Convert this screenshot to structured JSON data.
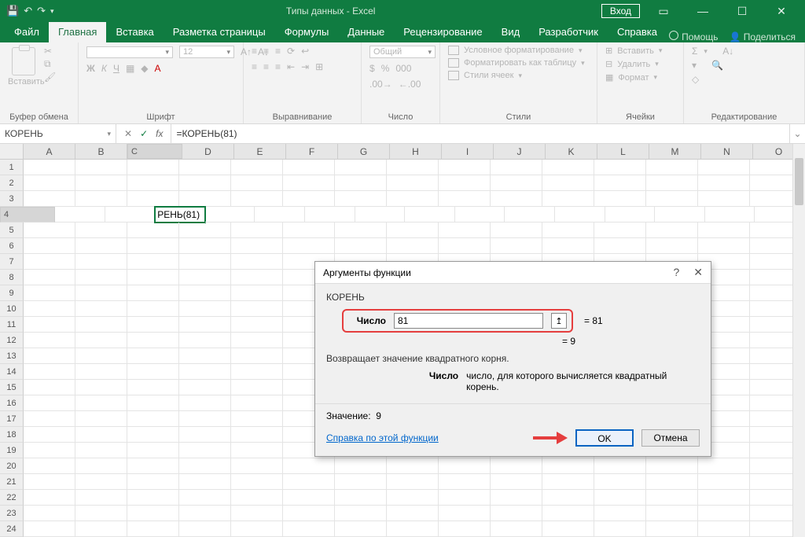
{
  "title": "Типы данных  -  Excel",
  "signin": "Вход",
  "tabs": {
    "file": "Файл",
    "home": "Главная",
    "insert": "Вставка",
    "layout": "Разметка страницы",
    "formulas": "Формулы",
    "data": "Данные",
    "review": "Рецензирование",
    "view": "Вид",
    "developer": "Разработчик",
    "help": "Справка",
    "tell": "Помощь",
    "share": "Поделиться"
  },
  "ribbon": {
    "clipboard": {
      "paste": "Вставить",
      "label": "Буфер обмена"
    },
    "font": {
      "name": "",
      "size": "12",
      "label": "Шрифт",
      "bold": "Ж",
      "italic": "К",
      "underline": "Ч"
    },
    "align": {
      "label": "Выравнивание"
    },
    "number": {
      "format": "Общий",
      "label": "Число",
      "currency": "$",
      "percent": "%",
      "thousands": "000"
    },
    "styles": {
      "cond": "Условное форматирование",
      "table": "Форматировать как таблицу",
      "cell": "Стили ячеек",
      "label": "Стили"
    },
    "cells": {
      "insert": "Вставить",
      "delete": "Удалить",
      "format": "Формат",
      "label": "Ячейки"
    },
    "editing": {
      "label": "Редактирование"
    }
  },
  "namebox": "КОРЕНЬ",
  "formula": "=КОРЕНЬ(81)",
  "columns": [
    "A",
    "B",
    "C",
    "D",
    "E",
    "F",
    "G",
    "H",
    "I",
    "J",
    "K",
    "L",
    "M",
    "N",
    "O"
  ],
  "rows": 24,
  "active_cell": {
    "row": 4,
    "col": 3,
    "display": "РЕНЬ(81)"
  },
  "dialog": {
    "title": "Аргументы функции",
    "fname": "КОРЕНЬ",
    "arg_label": "Число",
    "arg_value": "81",
    "arg_eval": "81",
    "result_eq": "9",
    "desc": "Возвращает значение квадратного корня.",
    "arg_name": "Число",
    "arg_desc": "число, для которого вычисляется квадратный корень.",
    "value_label": "Значение:",
    "value": "9",
    "help": "Справка по этой функции",
    "ok": "OK",
    "cancel": "Отмена"
  }
}
